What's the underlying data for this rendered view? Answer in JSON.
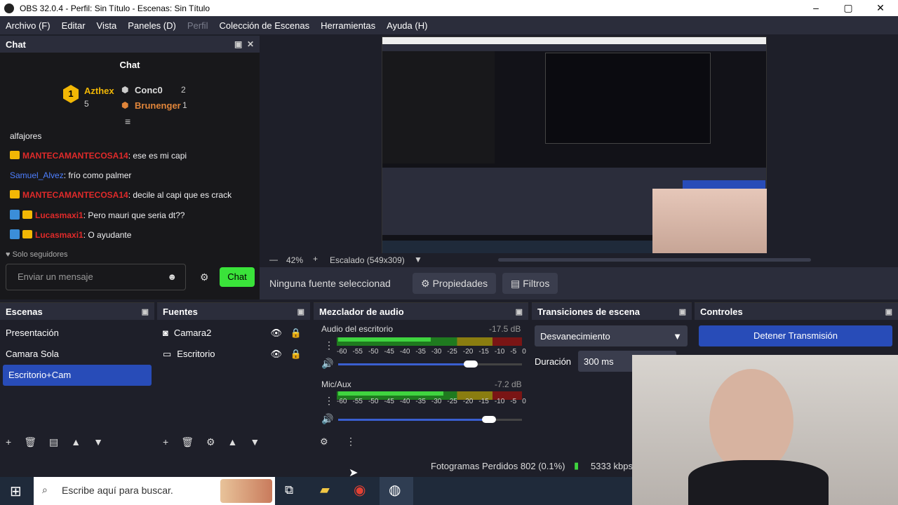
{
  "window": {
    "title": "OBS 32.0.4 - Perfil: Sin Título - Escenas: Sin Título"
  },
  "menu": [
    "Archivo (F)",
    "Editar",
    "Vista",
    "Paneles (D)",
    "Perfil",
    "Colección de Escenas",
    "Herramientas",
    "Ayuda (H)"
  ],
  "chat": {
    "dock_title": "Chat",
    "header": "Chat",
    "leaderboard": [
      {
        "rank": "1",
        "name": "Azthex",
        "count": "5"
      },
      {
        "rank": "2",
        "name": "Conc0",
        "count": "2"
      },
      {
        "rank": "3",
        "name": "Brunenger",
        "count": "1"
      }
    ],
    "messages": [
      {
        "user": "",
        "text": "alfajores"
      },
      {
        "user": "MANTECAMANTECOSA14",
        "text": ": ese es mi capi"
      },
      {
        "user": "Samuel_Alvez",
        "text": ": frío como palmer"
      },
      {
        "user": "MANTECAMANTECOSA14",
        "text": ": decile al capi que es crack"
      },
      {
        "user": "Lucasmaxi1",
        "text": ": Pero mauri que seria dt??"
      },
      {
        "user": "Lucasmaxi1",
        "text": ": O ayudante"
      }
    ],
    "followers_only": "Solo seguidores",
    "input_placeholder": "Enviar un mensaje",
    "send_label": "Chat"
  },
  "preview": {
    "zoom": "42%",
    "scale": "Escalado (549x309)"
  },
  "source_toolbar": {
    "no_source": "Ninguna fuente seleccionad",
    "properties": "Propiedades",
    "filters": "Filtros"
  },
  "scenes": {
    "title": "Escenas",
    "items": [
      "Presentación",
      "Camara Sola",
      "Escritorio+Cam"
    ]
  },
  "sources": {
    "title": "Fuentes",
    "items": [
      "Camara2",
      "Escritorio"
    ]
  },
  "mixer": {
    "title": "Mezclador de audio",
    "channels": [
      {
        "name": "Audio del escritorio",
        "db": "-17.5 dB",
        "level": 0.72
      },
      {
        "name": "Mic/Aux",
        "db": "-7.2 dB",
        "level": 0.82
      }
    ],
    "ticks": [
      "-60",
      "-55",
      "-50",
      "-45",
      "-40",
      "-35",
      "-30",
      "-25",
      "-20",
      "-15",
      "-10",
      "-5",
      "0"
    ]
  },
  "transitions": {
    "title": "Transiciones de escena",
    "type": "Desvanecimiento",
    "duration_label": "Duración",
    "duration": "300 ms"
  },
  "controls": {
    "title": "Controles",
    "stop_stream": "Detener Transmisión"
  },
  "status": {
    "dropped": "Fotogramas Perdidos 802 (0.1%)",
    "bitrate": "5333 kbps"
  },
  "taskbar": {
    "search_placeholder": "Escribe aquí para buscar."
  }
}
